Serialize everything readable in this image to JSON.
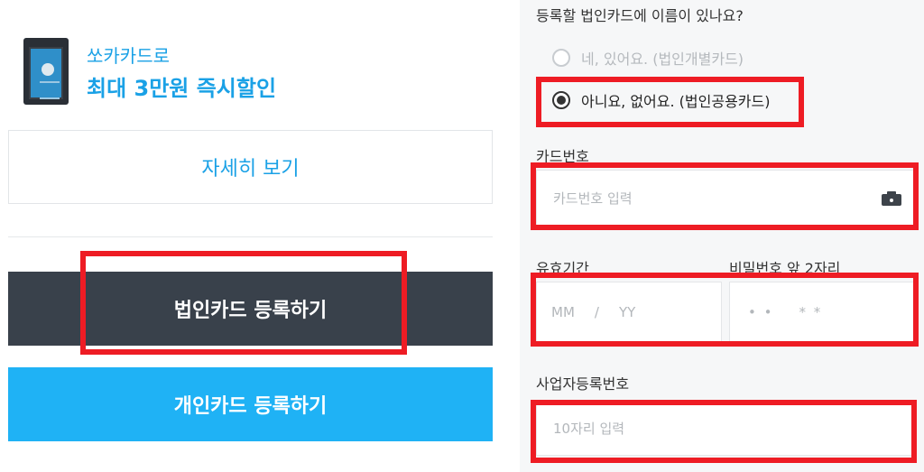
{
  "left_panel": {
    "promo": {
      "line1": "쏘카카드로",
      "line2": "최대 3만원 즉시할인"
    },
    "detail_button": "자세히 보기",
    "corporate_button": "법인카드 등록하기",
    "personal_button": "개인카드 등록하기"
  },
  "right_panel": {
    "name_question": "등록할 법인카드에 이름이 있나요?",
    "options": [
      {
        "label": "네, 있어요. (법인개별카드)",
        "selected": false
      },
      {
        "label": "아니요, 없어요. (법인공용카드)",
        "selected": true
      }
    ],
    "card_number": {
      "label": "카드번호",
      "placeholder": "카드번호 입력",
      "icon": "camera-icon"
    },
    "expiry": {
      "label": "유효기간",
      "month_placeholder": "MM",
      "separator": "/",
      "year_placeholder": "YY"
    },
    "password": {
      "label": "비밀번호 앞 2자리",
      "dots": "• •",
      "masked": "* *"
    },
    "business_number": {
      "label": "사업자등록번호",
      "placeholder": "10자리 입력"
    }
  },
  "colors": {
    "accent": "#1aa1e6",
    "corporate_button_bg": "#39414b",
    "personal_button_bg": "#1fb2f5",
    "highlight": "#ee1c24"
  }
}
